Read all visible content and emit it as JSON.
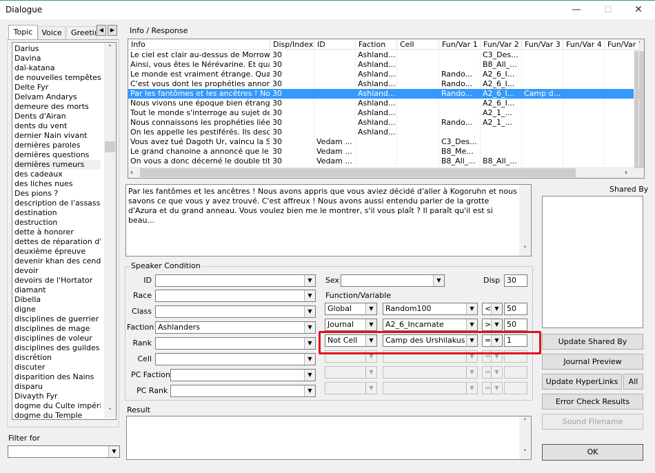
{
  "window": {
    "title": "Dialogue",
    "minimize": "—",
    "maximize": "☐",
    "close": "✕"
  },
  "tabs": [
    "Topic",
    "Voice",
    "Greeting"
  ],
  "tab_arrows": [
    "◀",
    "▶"
  ],
  "topics": [
    "Darius",
    "Davina",
    "daï-katana",
    "de nouvelles tempêtes ...",
    "Delte Fyr",
    "Delvam Andarys",
    "demeure des morts",
    "Dents d'Airan",
    "dents du vent",
    "dernier Nain vivant",
    "dernières paroles",
    "dernières questions",
    "dernières rumeurs",
    "des cadeaux",
    "des liches nues",
    "Des pions ?",
    "description de l'assassin",
    "destination",
    "destruction",
    "dette à honorer",
    "dettes de réparation d'...",
    "deuxième épreuve",
    "devenir khan des cend...",
    "devoir",
    "devoirs de l'Hortator",
    "diamant",
    "Dibella",
    "digne",
    "disciplines de guerrier",
    "disciplines de mage",
    "disciplines de voleur",
    "disciplines des guildes",
    "discrétion",
    "discuter",
    "disparition des Nains",
    "disparu",
    "Divayth Fyr",
    "dogme du Culte impérial",
    "dogme du Temple"
  ],
  "topics_selected_index": 12,
  "filter": {
    "label": "Filter for",
    "value": ""
  },
  "info_response": {
    "label": "Info / Response",
    "columns": [
      "Info",
      "Disp/Index",
      "ID",
      "Faction",
      "Cell",
      "Fun/Var 1",
      "Fun/Var 2",
      "Fun/Var 3",
      "Fun/Var 4",
      "Fun/Var"
    ],
    "rows": [
      [
        "Le ciel est clair au-dessus de Morrowin...",
        "30",
        "",
        "Ashland...",
        "",
        "",
        "C3_Des...",
        "",
        "",
        ""
      ],
      [
        "Ainsi, vous êtes le Nérévarine. Et quan...",
        "30",
        "",
        "Ashland...",
        "",
        "",
        "B8_All_...",
        "",
        "",
        ""
      ],
      [
        "Le monde est vraiment étrange. Quand...",
        "30",
        "",
        "Ashland...",
        "",
        "Rando...",
        "A2_6_I...",
        "",
        "",
        ""
      ],
      [
        "C'est vous dont les prophéties annonc...",
        "30",
        "",
        "Ashland...",
        "",
        "Rando...",
        "A2_6_I...",
        "",
        "",
        ""
      ],
      [
        "Par les fantômes et les ancêtres ! Nous...",
        "30",
        "",
        "Ashland...",
        "",
        "Rando...",
        "A2_6_I...",
        "Camp d...",
        "",
        ""
      ],
      [
        "Nous vivons une époque bien étrange....",
        "30",
        "",
        "Ashland...",
        "",
        "",
        "A2_6_I...",
        "",
        "",
        ""
      ],
      [
        "Tout le monde s'interroge au sujet de c...",
        "30",
        "",
        "Ashland...",
        "",
        "",
        "A2_1_...",
        "",
        "",
        ""
      ],
      [
        "Nous connaissons les prophéties liées ...",
        "30",
        "",
        "Ashland...",
        "",
        "Rando...",
        "A2_1_...",
        "",
        "",
        ""
      ],
      [
        "On les appelle les pestiférés. Ils descen...",
        "30",
        "",
        "Ashland...",
        "",
        "",
        "",
        "",
        "",
        ""
      ],
      [
        "Vous avez tué Dagoth Ur, vaincu la Si...",
        "30",
        "Vedam ...",
        "",
        "",
        "C3_Des...",
        "",
        "",
        "",
        ""
      ],
      [
        "Le grand chanoine a annoncé que le s...",
        "30",
        "Vedam ...",
        "",
        "",
        "B8_Me...",
        "",
        "",
        "",
        ""
      ],
      [
        "On vous a donc décerné le double titre...",
        "30",
        "Vedam ...",
        "",
        "",
        "B8_All_...",
        "B8_All_...",
        "",
        "",
        ""
      ]
    ],
    "selected_row": 4
  },
  "response_text": "Par les fantômes et les ancêtres ! Nous avons appris que vous aviez décidé d'aller à Kogoruhn et nous savons ce que vous y avez trouvé. C'est affreux ! Nous avons aussi entendu parler de la grotte d'Azura et du grand anneau. Vous voulez bien me le montrer, s'il vous plaît ? Il paraît qu'il est si beau...",
  "shared_by": {
    "label": "Shared By"
  },
  "speaker_condition": {
    "label": "Speaker Condition",
    "fields": [
      {
        "label": "ID",
        "value": ""
      },
      {
        "label": "Race",
        "value": ""
      },
      {
        "label": "Class",
        "value": ""
      },
      {
        "label": "Faction",
        "value": "Ashlanders"
      },
      {
        "label": "Rank",
        "value": ""
      },
      {
        "label": "Cell",
        "value": ""
      },
      {
        "label": "PC Faction",
        "value": ""
      },
      {
        "label": "PC Rank",
        "value": ""
      }
    ],
    "sex": {
      "label": "Sex",
      "value": ""
    },
    "disp": {
      "label": "Disp",
      "value": "30"
    },
    "function_variable_label": "Function/Variable",
    "functions": [
      {
        "type": "Global",
        "name": "Random100",
        "op": "<",
        "value": "50"
      },
      {
        "type": "Journal",
        "name": "A2_6_Incarnate",
        "op": ">=",
        "value": "50"
      },
      {
        "type": "Not Cell",
        "name": "Camp des Urshilakus",
        "op": "=",
        "value": "1"
      },
      {
        "type": "",
        "name": "",
        "op": "=",
        "value": ""
      },
      {
        "type": "",
        "name": "",
        "op": "=",
        "value": ""
      },
      {
        "type": "",
        "name": "",
        "op": "=",
        "value": ""
      }
    ]
  },
  "result": {
    "label": "Result",
    "value": ""
  },
  "buttons": {
    "update_shared_by": "Update Shared By",
    "journal_preview": "Journal Preview",
    "update_hyperlinks": "Update HyperLinks",
    "all": "All",
    "error_check": "Error Check Results",
    "sound_filename": "Sound Filename",
    "ok": "OK"
  },
  "highlight_color": "#e0101a",
  "selection_color": "#3399ff"
}
